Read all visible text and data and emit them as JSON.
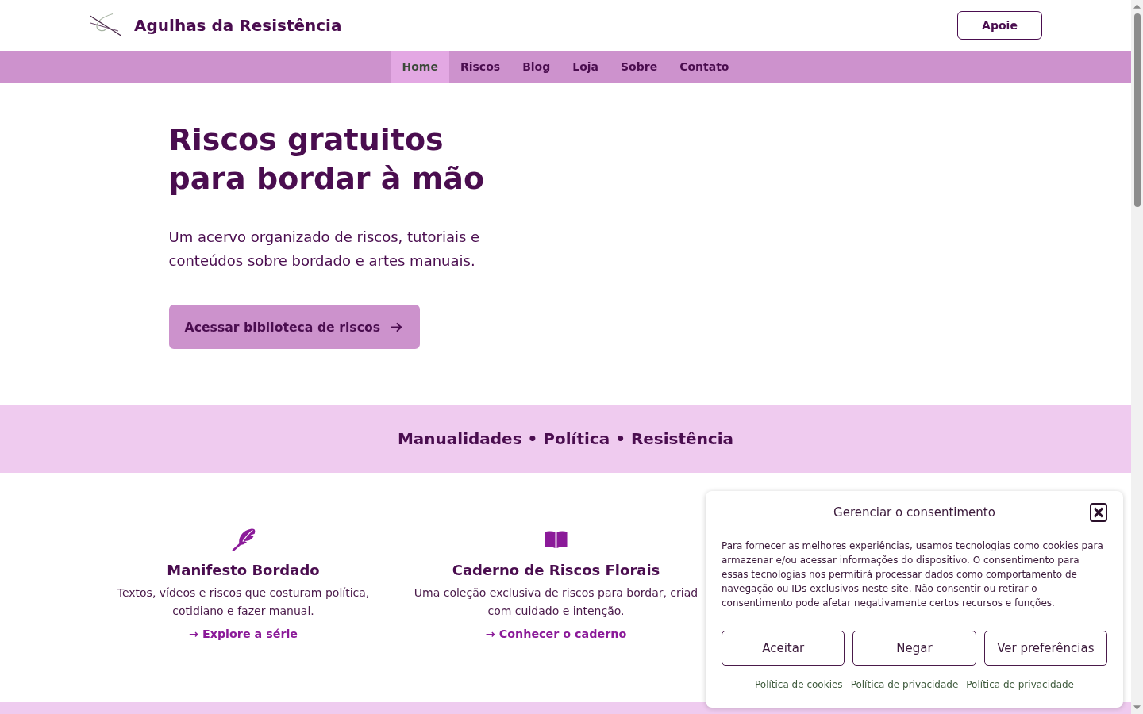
{
  "header": {
    "site_title": "Agulhas da Resistência",
    "support_button": "Apoie"
  },
  "nav": {
    "items": [
      {
        "label": "Home",
        "selected": true
      },
      {
        "label": "Riscos",
        "selected": false
      },
      {
        "label": "Blog",
        "selected": false
      },
      {
        "label": "Loja",
        "selected": false
      },
      {
        "label": "Sobre",
        "selected": false
      },
      {
        "label": "Contato",
        "selected": false
      }
    ]
  },
  "hero": {
    "title": "Riscos gratuitos para bordar à mão",
    "text": "Um acervo organizado de riscos, tutoriais e conteúdos sobre bordado e artes manuais.",
    "button": "Acessar biblioteca de riscos"
  },
  "tagline": "Manualidades • Política • Resistência",
  "features": [
    {
      "kind": "feather",
      "title": "Manifesto Bordado",
      "text": "Textos, vídeos e riscos que costuram política, cotidiano e fazer manual.",
      "link": "→ Explore a série"
    },
    {
      "kind": "book",
      "title": "Caderno de Riscos Florais",
      "text": "Uma coleção exclusiva de riscos para bordar, criad com cuidado e intenção.",
      "link": "→ Conhecer o caderno"
    }
  ],
  "consent": {
    "title": "Gerenciar o consentimento",
    "text": "Para fornecer as melhores experiências, usamos tecnologias como cookies para armazenar e/ou acessar informações do dispositivo. O consentimento para essas tecnologias nos permitirá processar dados como comportamento de navegação ou IDs exclusivos neste site. Não consentir ou retirar o consentimento pode afetar negativamente certos recursos e funções.",
    "buttons": [
      "Aceitar",
      "Negar",
      "Ver preferências"
    ],
    "links": [
      "Política de cookies",
      "Política de privacidade",
      "Política de privacidade"
    ]
  }
}
